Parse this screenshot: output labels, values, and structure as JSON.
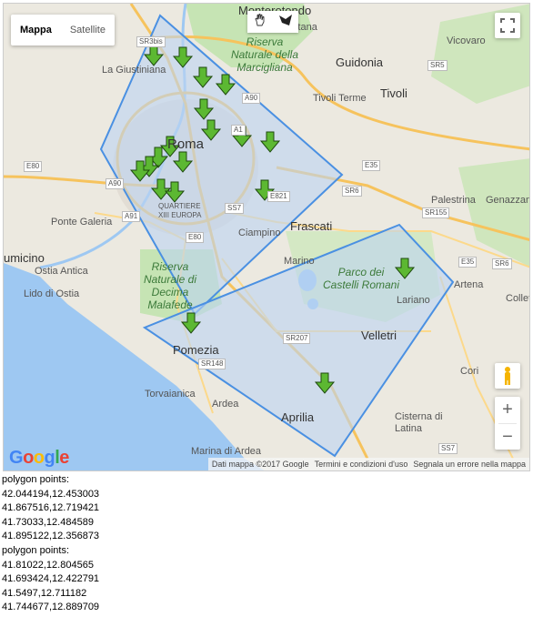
{
  "map": {
    "type_controls": {
      "map": "Mappa",
      "satellite": "Satellite",
      "selected": "Mappa"
    },
    "icons": {
      "pan": "hand-icon",
      "draw": "polygon-draw-icon",
      "fullscreen": "fullscreen-icon",
      "pegman": "street-view-pegman-icon",
      "zoom_in": "+",
      "zoom_out": "−"
    },
    "logo": "Google",
    "attribution": {
      "data": "Dati mappa ©2017 Google",
      "terms": "Termini e condizioni d'uso",
      "report": "Segnala un errore nella mappa"
    },
    "colors": {
      "polygon_fill": "#bcd3f2",
      "polygon_stroke": "#4a90e2",
      "marker": "#5cb832",
      "sea": "#9ec8f2",
      "park": "#c6e4b4"
    },
    "place_labels": {
      "monterotondo": "Monterotondo",
      "mentana": "Mentana",
      "la_giustiniana": "La Giustiniana",
      "riserva_marcigliana": "Riserva Naturale della Marcigliana",
      "guidonia": "Guidonia",
      "vicovaro": "Vicovaro",
      "tivoli_terme": "Tivoli Terme",
      "tivoli": "Tivoli",
      "roma": "Roma",
      "palestrina": "Palestrina",
      "genazzano": "Genazzano",
      "ponte_galeria": "Ponte Galeria",
      "fiumicino": "umicino",
      "ostia_antica": "Ostia Antica",
      "lido_ostia": "Lido di Ostia",
      "eur": "XIII EUROPA",
      "quartiere": "QUARTIERE",
      "ciampino": "Ciampino",
      "frascati": "Frascati",
      "marino": "Marino",
      "castelli": "Parco dei Castelli Romani",
      "lariano": "Lariano",
      "artena": "Artena",
      "colleferro": "Collef",
      "riserva_decima": "Riserva Naturale di Decima Malafede",
      "pomezia": "Pomezia",
      "velletri": "Velletri",
      "torvaianica": "Torvaianica",
      "ardea": "Ardea",
      "aprilia": "Aprilia",
      "cori": "Cori",
      "cisterna": "Cisterna di Latina",
      "marina_ardea": "Marina di Ardea"
    },
    "road_labels": [
      "SR3bis",
      "SR5",
      "A90",
      "A1",
      "E80",
      "A91",
      "E35",
      "SR6",
      "SS7",
      "E821",
      "SR155",
      "SR207",
      "SR148",
      "SS7",
      "E35",
      "SR6",
      "A90",
      "E80"
    ]
  },
  "output": {
    "lines": [
      "polygon points:",
      "42.044194,12.453003",
      "41.867516,12.719421",
      "41.73033,12.484589",
      "41.895122,12.356873",
      "polygon points:",
      "41.81022,12.804565",
      "41.693424,12.422791",
      "41.5497,12.711182",
      "41.744677,12.889709"
    ]
  }
}
